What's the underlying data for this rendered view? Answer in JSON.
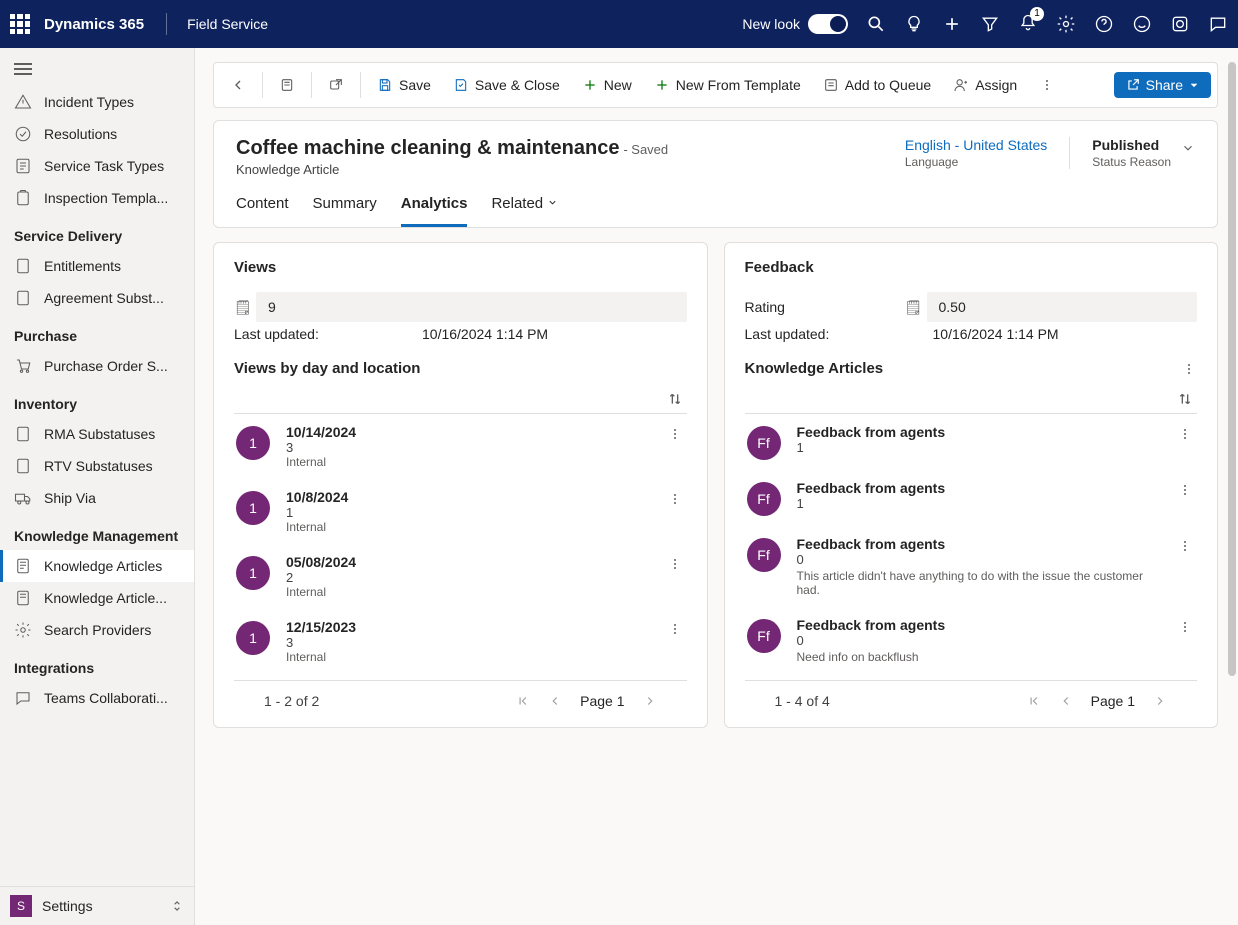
{
  "topbar": {
    "brand": "Dynamics 365",
    "app": "Field Service",
    "newlook": "New look",
    "notif_badge": "1"
  },
  "sidebar": {
    "g0": [
      {
        "label": "Incident Types"
      },
      {
        "label": "Resolutions"
      },
      {
        "label": "Service Task Types"
      },
      {
        "label": "Inspection Templa..."
      }
    ],
    "g1_title": "Service Delivery",
    "g1": [
      {
        "label": "Entitlements"
      },
      {
        "label": "Agreement Subst..."
      }
    ],
    "g2_title": "Purchase",
    "g2": [
      {
        "label": "Purchase Order S..."
      }
    ],
    "g3_title": "Inventory",
    "g3": [
      {
        "label": "RMA Substatuses"
      },
      {
        "label": "RTV Substatuses"
      },
      {
        "label": "Ship Via"
      }
    ],
    "g4_title": "Knowledge Management",
    "g4": [
      {
        "label": "Knowledge Articles"
      },
      {
        "label": "Knowledge Article..."
      },
      {
        "label": "Search Providers"
      }
    ],
    "g5_title": "Integrations",
    "g5": [
      {
        "label": "Teams Collaborati..."
      }
    ],
    "footer": "Settings"
  },
  "cmd": {
    "save": "Save",
    "saveclose": "Save & Close",
    "new": "New",
    "newtpl": "New From Template",
    "queue": "Add to Queue",
    "assign": "Assign",
    "share": "Share"
  },
  "record": {
    "title": "Coffee machine cleaning & maintenance",
    "saved": "- Saved",
    "entity": "Knowledge Article",
    "lang_val": "English - United States",
    "lang_lbl": "Language",
    "status_val": "Published",
    "status_lbl": "Status Reason",
    "tabs": {
      "content": "Content",
      "summary": "Summary",
      "analytics": "Analytics",
      "related": "Related"
    }
  },
  "views": {
    "title": "Views",
    "count": "9",
    "updated_lbl": "Last updated:",
    "updated_val": "10/16/2024 1:14 PM",
    "sub": "Views by day and location",
    "items": [
      {
        "badge": "1",
        "date": "10/14/2024",
        "count": "3",
        "loc": "Internal"
      },
      {
        "badge": "1",
        "date": "10/8/2024",
        "count": "1",
        "loc": "Internal"
      },
      {
        "badge": "1",
        "date": "05/08/2024",
        "count": "2",
        "loc": "Internal"
      },
      {
        "badge": "1",
        "date": "12/15/2023",
        "count": "3",
        "loc": "Internal"
      }
    ],
    "pager_range": "1 - 2 of 2",
    "pager_page": "Page 1"
  },
  "feedback": {
    "title": "Feedback",
    "rating_lbl": "Rating",
    "rating_val": "0.50",
    "updated_lbl": "Last updated:",
    "updated_val": "10/16/2024 1:14 PM",
    "sub": "Knowledge Articles",
    "items": [
      {
        "badge": "Ff",
        "title": "Feedback from agents",
        "count": "1",
        "note": ""
      },
      {
        "badge": "Ff",
        "title": "Feedback from agents",
        "count": "1",
        "note": ""
      },
      {
        "badge": "Ff",
        "title": "Feedback from agents",
        "count": "0",
        "note": "This article didn't have anything to do with the issue the customer had."
      },
      {
        "badge": "Ff",
        "title": "Feedback from agents",
        "count": "0",
        "note": "Need info on backflush"
      }
    ],
    "pager_range": "1 - 4 of 4",
    "pager_page": "Page 1"
  }
}
